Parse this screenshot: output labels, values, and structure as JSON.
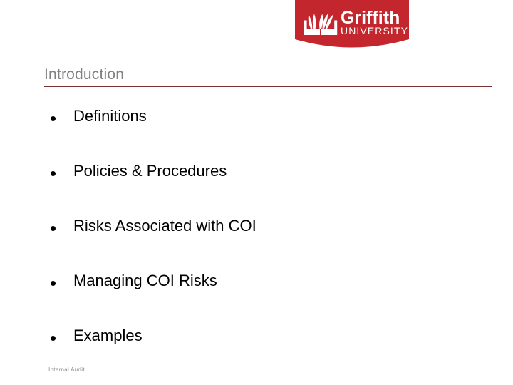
{
  "slide": {
    "background_color": "#ffffff",
    "heading": "Introduction",
    "heading_color": "#808080",
    "rule_color": "#7b3032",
    "footer": "Internal Audit",
    "footer_color": "#8c8c8c"
  },
  "logo": {
    "name": "griffith-university-logo",
    "wordmark": "Griffith",
    "subtitle": "UNIVERSITY",
    "shield_color": "#c4262e",
    "text_color": "#ffffff",
    "emblem": "open-book-flame-icon"
  },
  "bullets": [
    {
      "label": "Definitions"
    },
    {
      "label": "Policies & Procedures"
    },
    {
      "label": "Risks Associated with COI"
    },
    {
      "label": "Managing COI Risks"
    },
    {
      "label": "Examples"
    }
  ]
}
